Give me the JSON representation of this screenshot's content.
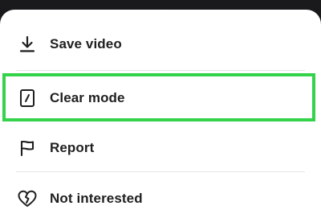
{
  "menu": {
    "items": [
      {
        "label": "Save video",
        "icon": "download-icon"
      },
      {
        "label": "Clear mode",
        "icon": "clear-mode-icon"
      },
      {
        "label": "Report",
        "icon": "flag-icon"
      },
      {
        "label": "Not interested",
        "icon": "broken-heart-icon"
      }
    ],
    "highlighted_item": "Clear mode"
  },
  "colors": {
    "highlight_border": "#35d24b",
    "sheet_background": "#ffffff",
    "text": "#1f1f1f"
  }
}
